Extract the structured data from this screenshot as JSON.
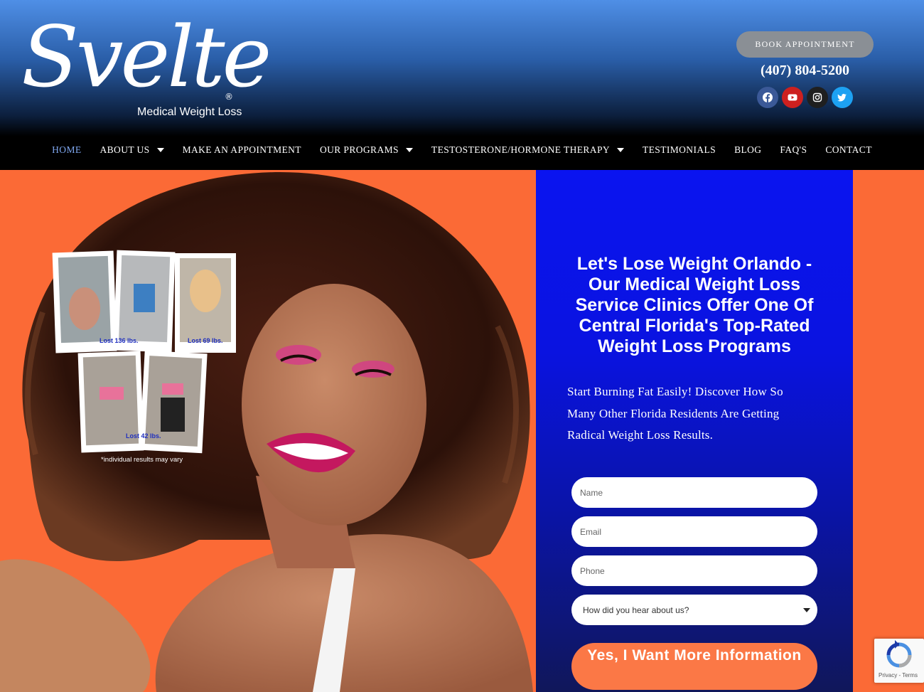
{
  "header": {
    "logo_script": "Svelte",
    "logo_registered": "®",
    "logo_subtitle": "Medical Weight Loss",
    "book_label": "BOOK APPOINTMENT",
    "phone": "(407) 804-5200",
    "socials": [
      "facebook-icon",
      "youtube-icon",
      "instagram-icon",
      "twitter-icon"
    ]
  },
  "nav": {
    "items": [
      {
        "label": "HOME",
        "active": true,
        "dropdown": false
      },
      {
        "label": "ABOUT US",
        "dropdown": true
      },
      {
        "label": "MAKE AN APPOINTMENT",
        "dropdown": false
      },
      {
        "label": "OUR PROGRAMS",
        "dropdown": true
      },
      {
        "label": "TESTOSTERONE/HORMONE THERAPY",
        "dropdown": true
      },
      {
        "label": "TESTIMONIALS",
        "dropdown": false
      },
      {
        "label": "BLOG",
        "dropdown": false
      },
      {
        "label": "FAQ'S",
        "dropdown": false
      },
      {
        "label": "CONTACT",
        "dropdown": false
      }
    ]
  },
  "hero": {
    "photos": [
      {
        "caption": "Lost 136 lbs."
      },
      {
        "caption": "Lost 69 lbs."
      },
      {
        "caption": "Lost 42 lbs."
      }
    ],
    "disclaimer": "*individual results may vary"
  },
  "form": {
    "title": "Let's Lose Weight Orlando -Our Medical Weight Loss Service Clinics Offer One Of Central Florida's Top-Rated Weight Loss Programs",
    "intro": "Start Burning Fat Easily! Discover How So Many Other Florida Residents Are Getting Radical Weight Loss Results.",
    "name_placeholder": "Name",
    "email_placeholder": "Email",
    "phone_placeholder": "Phone",
    "source_select": "How did you hear about us?",
    "submit_label": "Yes, I Want More Information"
  },
  "recaptcha": {
    "links": "Privacy - Terms"
  },
  "colors": {
    "header_top": "#4f8fe6",
    "hero_background": "#fb6a36",
    "form_panel": "#0a14f0",
    "submit_button": "#fb7846",
    "nav_active": "#7ea6ee"
  }
}
